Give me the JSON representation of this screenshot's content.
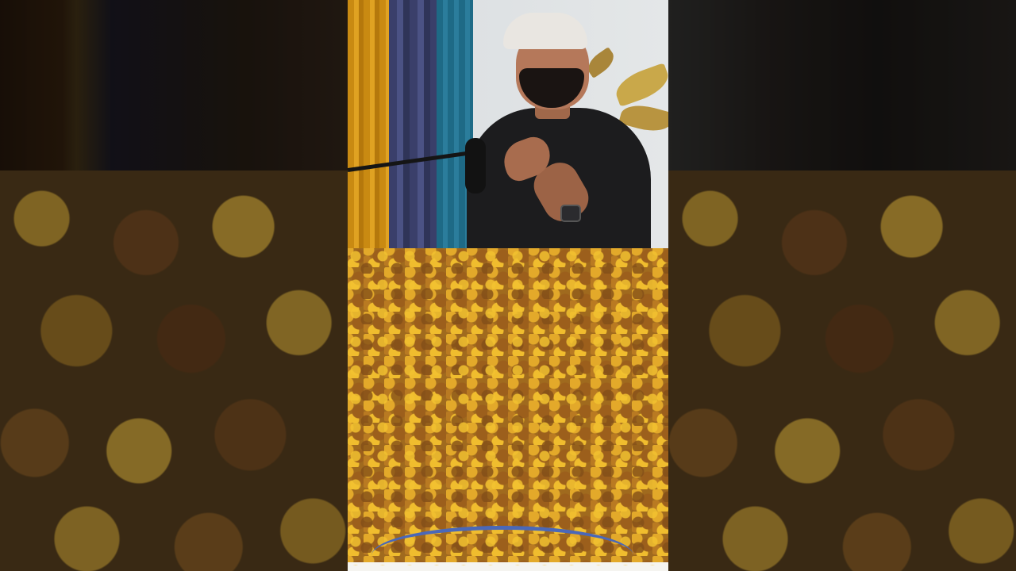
{
  "frame": {
    "layout": "vertical-video-with-blurred-sidebars",
    "colors": {
      "background": "#1a1510",
      "chickpea_gold": "#e3a92a",
      "chickpea_brown": "#9c5f1c",
      "curtain_yellow": "#c98a12",
      "curtain_blue": "#3a3f6a",
      "shirt": "#1c1c1e",
      "cap": "#e9e6e1",
      "plate_blue": "#5b79c6"
    }
  },
  "top_scene": {
    "description_icons": [
      "podcast-microphone",
      "wrist-watch",
      "baseball-cap"
    ]
  },
  "bottom_scene": {
    "icons": [
      "plate",
      "roasted-chickpeas"
    ]
  }
}
